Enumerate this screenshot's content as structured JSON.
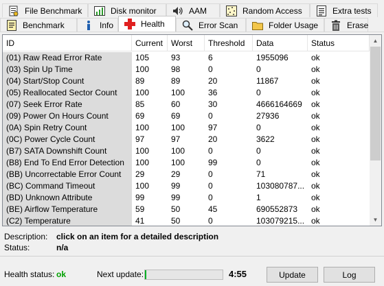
{
  "tabs_top": [
    {
      "label": "File Benchmark",
      "icon": "file-benchmark-icon"
    },
    {
      "label": "Disk monitor",
      "icon": "disk-monitor-icon"
    },
    {
      "label": "AAM",
      "icon": "speaker-icon"
    },
    {
      "label": "Random Access",
      "icon": "random-access-icon"
    },
    {
      "label": "Extra tests",
      "icon": "extra-tests-icon"
    }
  ],
  "tabs_bottom": [
    {
      "label": "Benchmark",
      "icon": "benchmark-icon"
    },
    {
      "label": "Info",
      "icon": "info-icon"
    },
    {
      "label": "Health",
      "icon": "health-cross-icon"
    },
    {
      "label": "Error Scan",
      "icon": "magnifier-icon"
    },
    {
      "label": "Folder Usage",
      "icon": "folder-icon"
    },
    {
      "label": "Erase",
      "icon": "trash-icon"
    }
  ],
  "table": {
    "headers": [
      "ID",
      "Current",
      "Worst",
      "Threshold",
      "Data",
      "Status"
    ],
    "rows": [
      [
        "(01) Raw Read Error Rate",
        "105",
        "93",
        "6",
        "1955096",
        "ok"
      ],
      [
        "(03) Spin Up Time",
        "100",
        "98",
        "0",
        "0",
        "ok"
      ],
      [
        "(04) Start/Stop Count",
        "89",
        "89",
        "20",
        "11867",
        "ok"
      ],
      [
        "(05) Reallocated Sector Count",
        "100",
        "100",
        "36",
        "0",
        "ok"
      ],
      [
        "(07) Seek Error Rate",
        "85",
        "60",
        "30",
        "4666164669",
        "ok"
      ],
      [
        "(09) Power On Hours Count",
        "69",
        "69",
        "0",
        "27936",
        "ok"
      ],
      [
        "(0A) Spin Retry Count",
        "100",
        "100",
        "97",
        "0",
        "ok"
      ],
      [
        "(0C) Power Cycle Count",
        "97",
        "97",
        "20",
        "3622",
        "ok"
      ],
      [
        "(B7) SATA Downshift Count",
        "100",
        "100",
        "0",
        "0",
        "ok"
      ],
      [
        "(B8) End To End Error Detection",
        "100",
        "100",
        "99",
        "0",
        "ok"
      ],
      [
        "(BB) Uncorrectable Error Count",
        "29",
        "29",
        "0",
        "71",
        "ok"
      ],
      [
        "(BC) Command Timeout",
        "100",
        "99",
        "0",
        "103080787...",
        "ok"
      ],
      [
        "(BD) Unknown Attribute",
        "99",
        "99",
        "0",
        "1",
        "ok"
      ],
      [
        "(BE) Airflow Temperature",
        "59",
        "50",
        "45",
        "690552873",
        "ok"
      ],
      [
        "(C2) Temperature",
        "41",
        "50",
        "0",
        "103079215...",
        "ok"
      ]
    ]
  },
  "description": {
    "label": "Description:",
    "value": "click on an item for a detailed description"
  },
  "status": {
    "label": "Status:",
    "value": "n/a"
  },
  "footer": {
    "health_label": "Health status:",
    "health_value": "ok",
    "next_update_label": "Next update:",
    "progress_fraction": 0.02,
    "timer": "4:55",
    "update_button": "Update",
    "log_button": "Log"
  },
  "colors": {
    "health_ok": "#00a000",
    "progress": "#06b025",
    "id_column_bg": "#dcdcdc"
  }
}
